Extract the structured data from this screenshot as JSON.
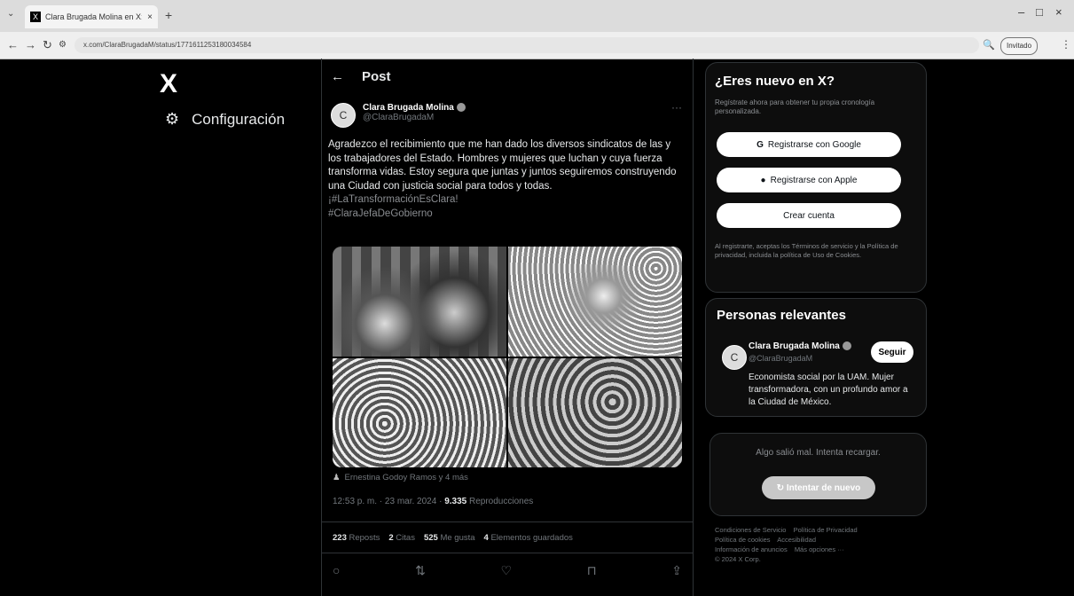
{
  "browser": {
    "tab_title": "Clara Brugada Molina en X: \"A",
    "tab_close": "×",
    "new_tab": "+",
    "url": "x.com/ClaraBrugadaM/status/1771611253180034584",
    "guest_label": "Invitado",
    "minimize": "–",
    "maximize": "□",
    "close": "×"
  },
  "sidebar": {
    "logo": "X",
    "settings_label": "Configuración"
  },
  "post": {
    "header_title": "Post",
    "author_name": "Clara Brugada Molina",
    "author_handle": "@ClaraBrugadaM",
    "avatar_initial": "C",
    "text": "Agradezco el recibimiento que me han dado los diversos sindicatos de las y los trabajadores del Estado. Hombres y mujeres que luchan y cuya fuerza transforma vidas. Estoy segura que juntas y juntos seguiremos construyendo una Ciudad con justicia social para todos y todas.",
    "hashtag1": "¡#LaTransformaciónEsClara!",
    "hashtag2": "#ClaraJefaDeGobierno",
    "tagged": "Ernestina Godoy Ramos y 4 más",
    "timestamp": "12:53 p. m. · 23 mar. 2024 · ",
    "views_count": "9.335",
    "views_label": " Reproducciones",
    "reposts_count": "223",
    "reposts_label": "Reposts",
    "quotes_count": "2",
    "quotes_label": "Citas",
    "likes_count": "525",
    "likes_label": "Me gusta",
    "bookmarks_count": "4",
    "bookmarks_label": "Elementos guardados"
  },
  "signup": {
    "title": "¿Eres nuevo en X?",
    "description": "Regístrate ahora para obtener tu propia cronología personalizada.",
    "google_label": "Registrarse con Google",
    "apple_label": "Registrarse con Apple",
    "create_label": "Crear cuenta",
    "legal": "Al registrarte, aceptas los Términos de servicio y la Política de privacidad, incluida la política de Uso de Cookies."
  },
  "relevant": {
    "title": "Personas relevantes",
    "name": "Clara Brugada Molina",
    "handle": "@ClaraBrugadaM",
    "follow_label": "Seguir",
    "bio": "Economista social por la UAM. Mujer transformadora, con un profundo amor a la Ciudad de México."
  },
  "error_card": {
    "message": "Algo salió mal. Intenta recargar.",
    "retry_label": "Intentar de nuevo"
  },
  "footer": {
    "links": [
      "Condiciones de Servicio",
      "Política de Privacidad",
      "Política de cookies",
      "Accesibilidad",
      "Información de anuncios",
      "Más opciones ···",
      "© 2024 X Corp."
    ]
  }
}
